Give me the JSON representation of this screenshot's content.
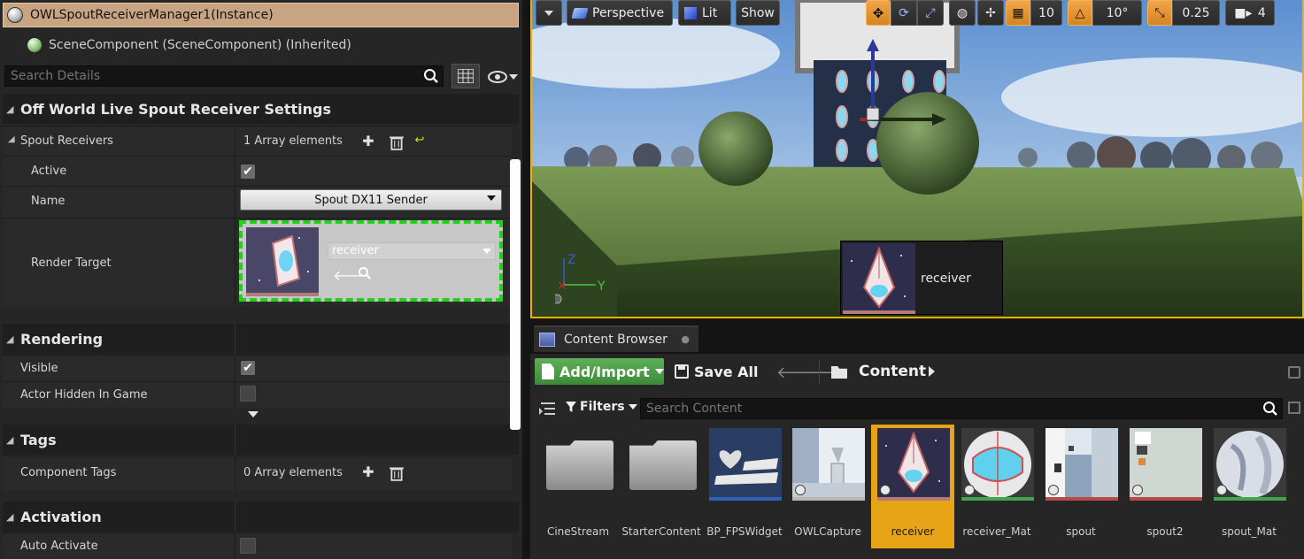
{
  "details": {
    "component_instance": "OWLSpoutReceiverManager1(Instance)",
    "component_scene": "SceneComponent (SceneComponent) (Inherited)",
    "search_placeholder": "Search Details"
  },
  "sections": {
    "owl": {
      "title": "Off World Live Spout Receiver Settings",
      "spout_receivers_label": "Spout Receivers",
      "spout_receivers_value": "1 Array elements",
      "active_label": "Active",
      "active_checked": true,
      "name_label": "Name",
      "name_value": "Spout DX11 Sender",
      "render_target_label": "Render Target",
      "render_target_value": "receiver"
    },
    "rendering": {
      "title": "Rendering",
      "visible_label": "Visible",
      "visible_checked": true,
      "actor_hidden_label": "Actor Hidden In Game",
      "actor_hidden_checked": false
    },
    "tags": {
      "title": "Tags",
      "component_tags_label": "Component Tags",
      "component_tags_value": "0 Array elements"
    },
    "activation": {
      "title": "Activation",
      "auto_activate_label": "Auto Activate",
      "auto_activate_checked": false
    }
  },
  "viewport": {
    "perspective": "Perspective",
    "lit": "Lit",
    "show": "Show",
    "grid_snap": "10",
    "rotation_snap": "10°",
    "scale_snap": "0.25",
    "camera_speed": "4",
    "gizmo_z": "Z",
    "gizmo_y": "Y",
    "hover_label": "receiver",
    "highlight_color": "#f0b000"
  },
  "content_browser": {
    "tab_label": "Content Browser",
    "add_import": "Add/Import",
    "save_all": "Save All",
    "path": "Content",
    "filters": "Filters",
    "search_placeholder": "Search Content",
    "assets": [
      {
        "name": "CineStream",
        "kind": "folder"
      },
      {
        "name": "StarterContent",
        "kind": "folder"
      },
      {
        "name": "BP_FPSWidget",
        "kind": "widget",
        "strip": "#2c63b8"
      },
      {
        "name": "OWLCapture",
        "kind": "capture",
        "strip": "#b8b8b8"
      },
      {
        "name": "receiver",
        "kind": "render_target",
        "strip": "#b47a7a",
        "selected": true
      },
      {
        "name": "receiver_Mat",
        "kind": "material",
        "strip": "#3fa64a"
      },
      {
        "name": "spout",
        "kind": "texture",
        "strip": "#b84a4a"
      },
      {
        "name": "spout2",
        "kind": "texture",
        "strip": "#b84a4a"
      },
      {
        "name": "spout_Mat",
        "kind": "material",
        "strip": "#3fa64a"
      }
    ],
    "selection_color": "#e8a417",
    "add_button_color": "#4c9e47"
  }
}
